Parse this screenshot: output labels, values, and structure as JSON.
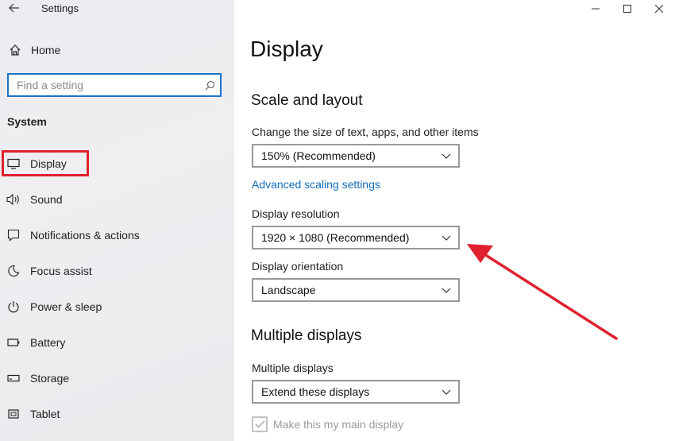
{
  "window": {
    "title": "Settings",
    "controls": [
      "minimize",
      "maximize",
      "close"
    ]
  },
  "sidebar": {
    "home_label": "Home",
    "search": {
      "placeholder": "Find a setting"
    },
    "section_title": "System",
    "items": [
      {
        "label": "Display",
        "icon": "monitor-icon",
        "selected": true
      },
      {
        "label": "Sound",
        "icon": "speaker-icon"
      },
      {
        "label": "Notifications & actions",
        "icon": "notification-icon"
      },
      {
        "label": "Focus assist",
        "icon": "moon-icon"
      },
      {
        "label": "Power & sleep",
        "icon": "power-icon"
      },
      {
        "label": "Battery",
        "icon": "battery-icon"
      },
      {
        "label": "Storage",
        "icon": "storage-icon"
      },
      {
        "label": "Tablet",
        "icon": "tablet-icon"
      }
    ]
  },
  "main": {
    "title": "Display",
    "scale_section": {
      "heading": "Scale and layout",
      "scale_label": "Change the size of text, apps, and other items",
      "scale_value": "150% (Recommended)",
      "advanced_link": "Advanced scaling settings",
      "resolution_label": "Display resolution",
      "resolution_value": "1920 × 1080 (Recommended)",
      "orientation_label": "Display orientation",
      "orientation_value": "Landscape"
    },
    "multiple_section": {
      "heading": "Multiple displays",
      "label": "Multiple displays",
      "value": "Extend these displays",
      "main_display_checkbox": "Make this my main display",
      "main_display_checked": true
    }
  },
  "colors": {
    "accent": "#1a73c9",
    "link": "#0f6cbd",
    "annotation": "#e0212e"
  }
}
